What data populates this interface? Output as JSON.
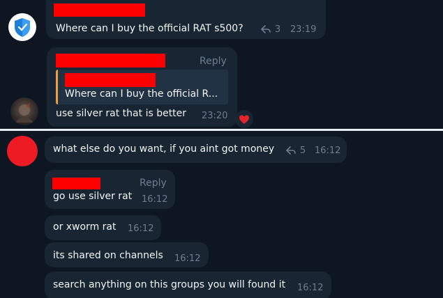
{
  "colors": {
    "background": "#0e1621",
    "bubble": "#182533",
    "redaction": "#ff0000",
    "muted": "#6d7f8f",
    "quote_accent": "#f0a040",
    "heart": "#e5252c"
  },
  "icons": {
    "forward": "forward-arrow-icon",
    "shield_avatar": "shield-check-icon",
    "heart": "heart-reaction-icon"
  },
  "top_thread": {
    "message_1": {
      "text": "Where can I buy the official RAT s500?",
      "forward_count": "3",
      "time": "23:19"
    },
    "message_2": {
      "reply_label": "Reply",
      "quote_text": "Where can I buy the official R...",
      "text": "use silver rat that is better",
      "time": "23:20"
    }
  },
  "bottom_thread": {
    "messages": [
      {
        "text": "what else do you want, if you aint got money",
        "forward_count": "5",
        "time": "16:12"
      },
      {
        "reply_label": "Reply",
        "text": "go use silver rat",
        "time": "16:12"
      },
      {
        "text": "or xworm rat",
        "time": "16:12"
      },
      {
        "text": "its shared on channels",
        "time": "16:12"
      },
      {
        "text": "search anything on this groups you will found it",
        "time": "16:12"
      }
    ]
  }
}
